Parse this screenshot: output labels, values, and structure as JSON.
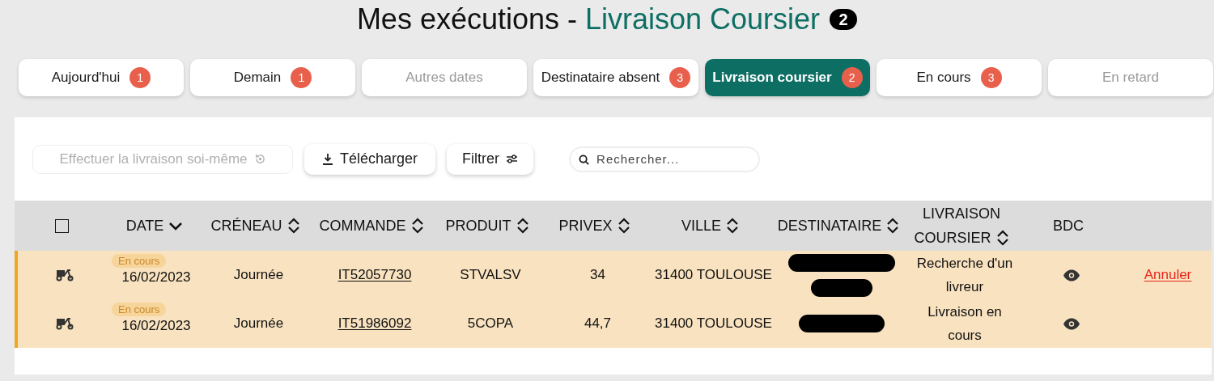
{
  "title": {
    "prefix": "Mes exécutions - ",
    "highlight": "Livraison Coursier",
    "count": "2"
  },
  "tabs": [
    {
      "label": "Aujourd'hui",
      "count": "1",
      "selected": false,
      "disabled": false
    },
    {
      "label": "Demain",
      "count": "1",
      "selected": false,
      "disabled": false
    },
    {
      "label": "Autres dates",
      "selected": false,
      "disabled": true
    },
    {
      "label": "Destinataire absent",
      "count": "3",
      "selected": false,
      "disabled": false
    },
    {
      "label": "Livraison coursier",
      "count": "2",
      "selected": true,
      "disabled": false
    },
    {
      "label": "En cours",
      "count": "3",
      "selected": false,
      "disabled": false
    },
    {
      "label": "En retard",
      "selected": false,
      "disabled": true
    }
  ],
  "toolbar": {
    "self_delivery": {
      "label": "Effectuer la livraison soi-même",
      "disabled": true
    },
    "download": "Télécharger",
    "filter": "Filtrer",
    "search": {
      "placeholder": "Rechercher..."
    }
  },
  "table": {
    "columns": [
      {
        "kind": "checkbox",
        "checked": false
      },
      {
        "label": "DATE",
        "kind": "sorted"
      },
      {
        "label": "CRÉNEAU",
        "kind": "sortable"
      },
      {
        "label": "COMMANDE",
        "kind": "sortable"
      },
      {
        "label": "PRODUIT",
        "kind": "sortable"
      },
      {
        "label": "PRIVEX",
        "kind": "sortable"
      },
      {
        "label": "VILLE",
        "kind": "sortable"
      },
      {
        "label": "DESTINATAIRE",
        "kind": "sortable"
      },
      {
        "label": "LIVRAISON COURSIER",
        "kind": "sortable"
      },
      {
        "label": "BDC",
        "kind": "plain"
      },
      {
        "kind": "blank"
      }
    ],
    "rows": [
      {
        "status": "En cours",
        "date": "16/02/2023",
        "slot": "Journée",
        "order": "IT52057730",
        "product": "STVALSV",
        "privex": "34",
        "city": "31400 TOULOUSE",
        "recipient_bars": [
          {
            "kind": "long"
          },
          {
            "kind": "short"
          }
        ],
        "courier_status": "Recherche d'un livreur",
        "action": "Annuler"
      },
      {
        "status": "En cours",
        "date": "16/02/2023",
        "slot": "Journée",
        "order": "IT51986092",
        "product": "5COPA",
        "privex": "44,7",
        "city": "31400 TOULOUSE",
        "recipient_bars": [
          {
            "kind": "medium"
          }
        ],
        "courier_status": "Livraison en cours"
      }
    ]
  }
}
